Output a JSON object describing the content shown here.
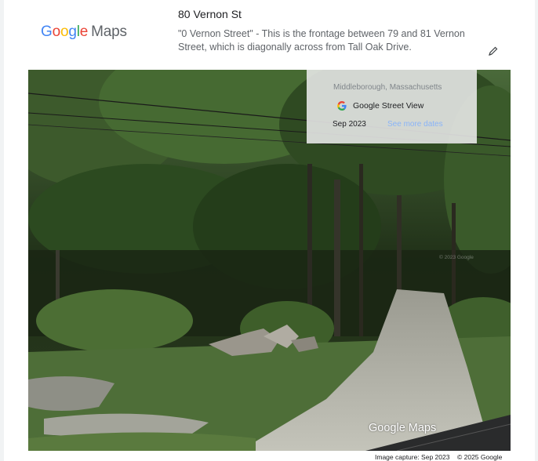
{
  "header": {
    "logo_google": "Google",
    "logo_maps": "Maps",
    "place_title": "80 Vernon St",
    "place_description": "\"0 Vernon Street\" - This is the frontage between 79 and 81 Vernon Street, which is diagonally across from Tall Oak Drive.",
    "edit_icon": "pencil-icon"
  },
  "info_card": {
    "location": "Middleborough, Massachusetts",
    "service_label": "Google Street View",
    "service_icon": "google-g-icon",
    "date": "Sep 2023",
    "see_more_label": "See more dates"
  },
  "street_view": {
    "watermark": "© 2023 Google",
    "logo_text": "Google Maps"
  },
  "footer": {
    "capture": "Image capture: Sep 2023",
    "copyright": "© 2025 Google"
  },
  "colors": {
    "link": "#8ab4f8",
    "text_secondary": "#5f6368",
    "google_blue": "#4285F4",
    "google_red": "#EA4335",
    "google_yellow": "#FBBC05",
    "google_green": "#34A853"
  }
}
